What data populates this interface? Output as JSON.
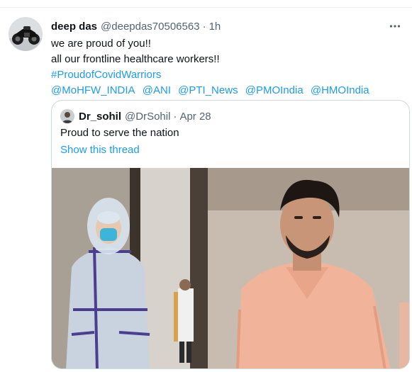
{
  "tweet": {
    "author_name": "deep das",
    "author_handle": "@deepdas70506563",
    "separator": "·",
    "time": "1h",
    "lines": [
      "we are proud of you!!",
      "all our frontline healthcare workers!!"
    ],
    "hashtag": "#ProudofCovidWarriors",
    "mentions": [
      "@MoHFW_INDIA",
      "@ANI",
      "@PTI_News",
      "@PMOIndia",
      "@HMOIndia"
    ],
    "more_icon": "more-horizontal-icon"
  },
  "quoted_tweet": {
    "author_name": "Dr_sohil",
    "author_handle": "@DrSohil",
    "separator": "·",
    "date": "Apr 28",
    "text": "Proud to serve the nation",
    "show_thread": "Show this thread",
    "photo": "photo-healthcare-workers"
  },
  "colors": {
    "link": "#1d9bf0",
    "secondary_text": "#536471",
    "border": "#cfd9de"
  }
}
